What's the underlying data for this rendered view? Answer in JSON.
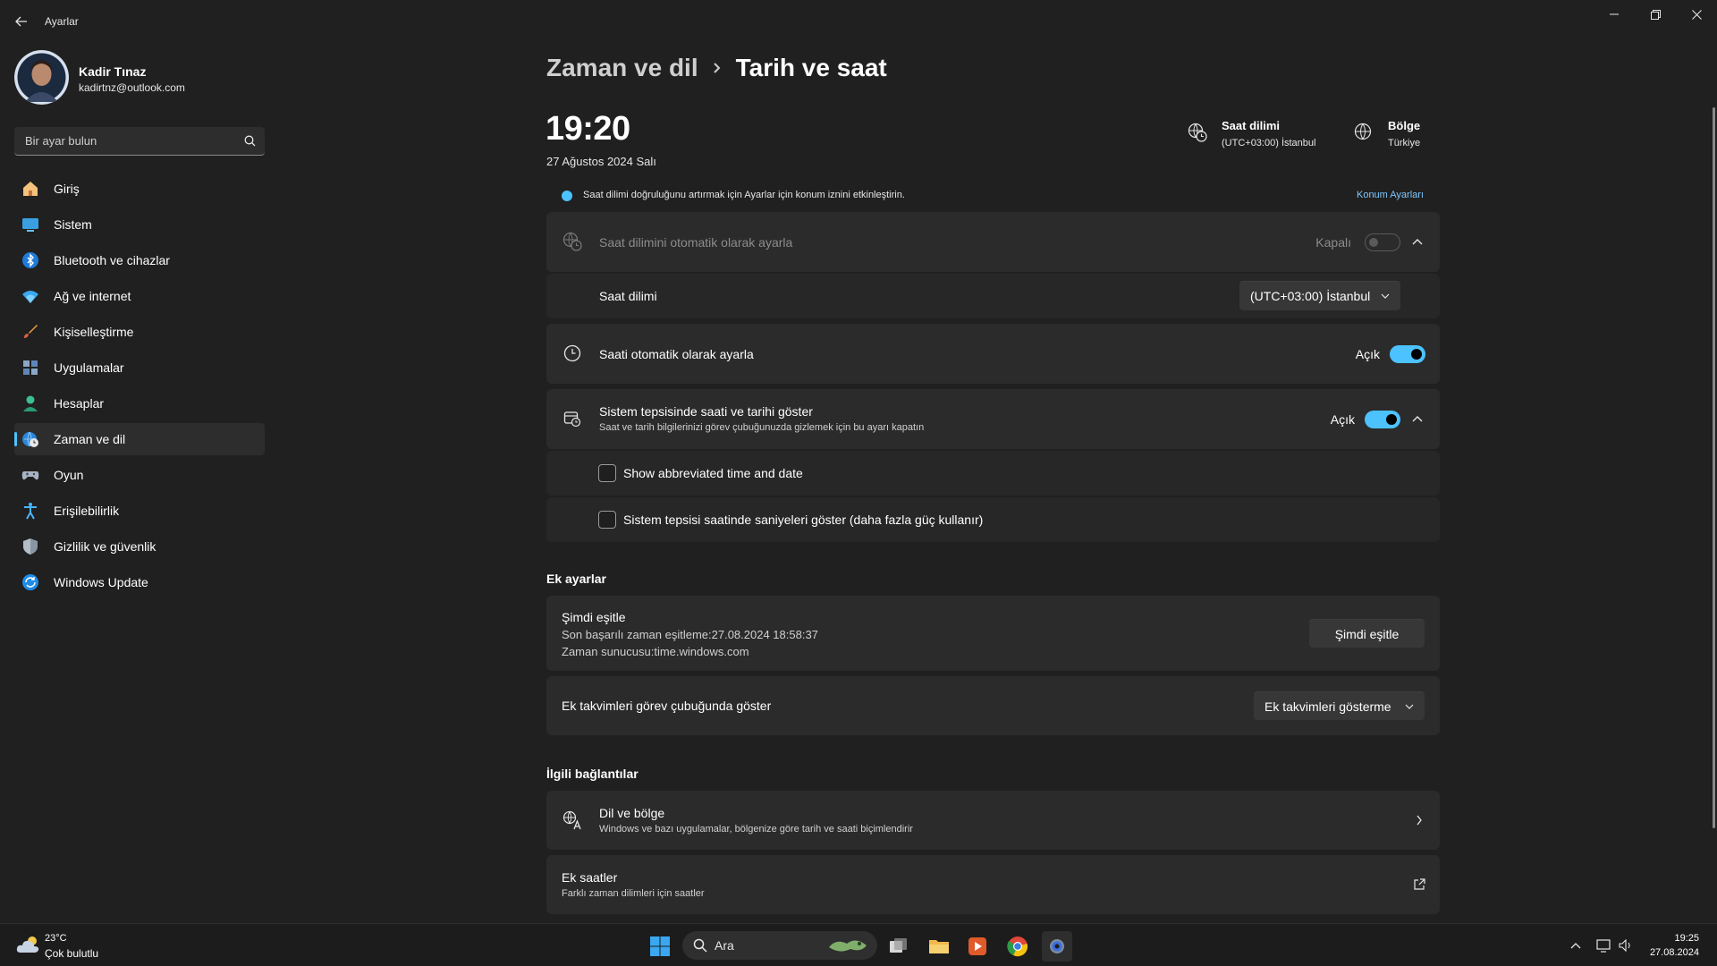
{
  "window": {
    "title": "Ayarlar"
  },
  "profile": {
    "name": "Kadir Tınaz",
    "email": "kadirtnz@outlook.com"
  },
  "search": {
    "placeholder": "Bir ayar bulun"
  },
  "nav": {
    "items": [
      {
        "label": "Giriş",
        "icon": "home-icon"
      },
      {
        "label": "Sistem",
        "icon": "system-icon"
      },
      {
        "label": "Bluetooth ve cihazlar",
        "icon": "bluetooth-icon"
      },
      {
        "label": "Ağ ve internet",
        "icon": "wifi-icon"
      },
      {
        "label": "Kişiselleştirme",
        "icon": "brush-icon"
      },
      {
        "label": "Uygulamalar",
        "icon": "apps-icon"
      },
      {
        "label": "Hesaplar",
        "icon": "person-icon"
      },
      {
        "label": "Zaman ve dil",
        "icon": "globe-clock-icon",
        "active": true
      },
      {
        "label": "Oyun",
        "icon": "gamepad-icon"
      },
      {
        "label": "Erişilebilirlik",
        "icon": "accessibility-icon"
      },
      {
        "label": "Gizlilik ve güvenlik",
        "icon": "shield-icon"
      },
      {
        "label": "Windows Update",
        "icon": "update-icon"
      }
    ]
  },
  "breadcrumb": {
    "parent": "Zaman ve dil",
    "current": "Tarih ve saat"
  },
  "clock": {
    "time": "19:20",
    "date": "27 Ağustos 2024 Salı"
  },
  "header_info": {
    "timezone": {
      "title": "Saat dilimi",
      "value": "(UTC+03:00) İstanbul"
    },
    "region": {
      "title": "Bölge",
      "value": "Türkiye"
    }
  },
  "notice": {
    "text": "Saat dilimi doğruluğunu artırmak için Ayarlar için konum iznini etkinleştirin.",
    "link": "Konum Ayarları"
  },
  "settings": {
    "auto_timezone": {
      "label": "Saat dilimini otomatik olarak ayarla",
      "state": "Kapalı",
      "enabled": false
    },
    "timezone": {
      "label": "Saat dilimi",
      "value": "(UTC+03:00) İstanbul"
    },
    "auto_time": {
      "label": "Saati otomatik olarak ayarla",
      "state": "Açık",
      "enabled": true
    },
    "tray_clock": {
      "label": "Sistem tepsisinde saati ve tarihi göster",
      "desc": "Saat ve tarih bilgilerinizi görev çubuğunuzda gizlemek için bu ayarı kapatın",
      "state": "Açık",
      "enabled": true
    },
    "abbreviated": {
      "label": "Show abbreviated time and date",
      "checked": false
    },
    "seconds": {
      "label": "Sistem tepsisi saatinde saniyeleri göster (daha fazla güç kullanır)",
      "checked": false
    }
  },
  "ek_ayarlar": {
    "title": "Ek ayarlar",
    "sync": {
      "label": "Şimdi eşitle",
      "last_sync": "Son başarılı zaman eşitleme:27.08.2024 18:58:37",
      "server": "Zaman sunucusu:time.windows.com",
      "button": "Şimdi eşitle"
    },
    "calendars": {
      "label": "Ek takvimleri görev çubuğunda göster",
      "value": "Ek takvimleri gösterme"
    }
  },
  "related": {
    "title": "İlgili bağlantılar",
    "language": {
      "label": "Dil ve bölge",
      "desc": "Windows ve bazı uygulamalar, bölgenize göre tarih ve saati biçimlendirir"
    },
    "clocks": {
      "label": "Ek saatler",
      "desc": "Farklı zaman dilimleri için saatler"
    }
  },
  "taskbar": {
    "weather": {
      "temp": "23°C",
      "desc": "Çok bulutlu"
    },
    "search_label": "Ara",
    "time": "19:25",
    "date": "27.08.2024"
  },
  "colors": {
    "accent": "#4cc2ff",
    "background": "#202020",
    "card": "#2b2b2b"
  }
}
